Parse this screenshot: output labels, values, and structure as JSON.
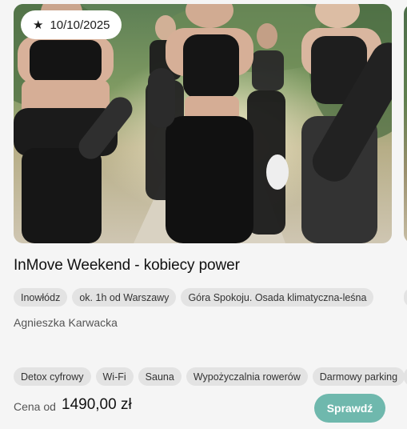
{
  "card": {
    "date": "10/10/2025",
    "title": "InMove Weekend - kobiecy power",
    "location_tags": [
      "Inowłódz",
      "ok. 1h od Warszawy",
      "Góra Spokoju. Osada klimatyczna-leśna"
    ],
    "host": "Agnieszka Karwacka",
    "amenity_tags": [
      "Detox cyfrowy",
      "Wi-Fi",
      "Sauna",
      "Wypożyczalnia rowerów",
      "Darmowy parking"
    ],
    "price_label": "Cena od",
    "price_value": "1490,00 zł",
    "cta_label": "Sprawdź"
  },
  "icons": {
    "date": "star-icon",
    "favorite": "heart-icon"
  },
  "colors": {
    "accent": "#6fb8ad",
    "tag_bg": "#e3e3e3",
    "page_bg": "#f5f5f5"
  }
}
